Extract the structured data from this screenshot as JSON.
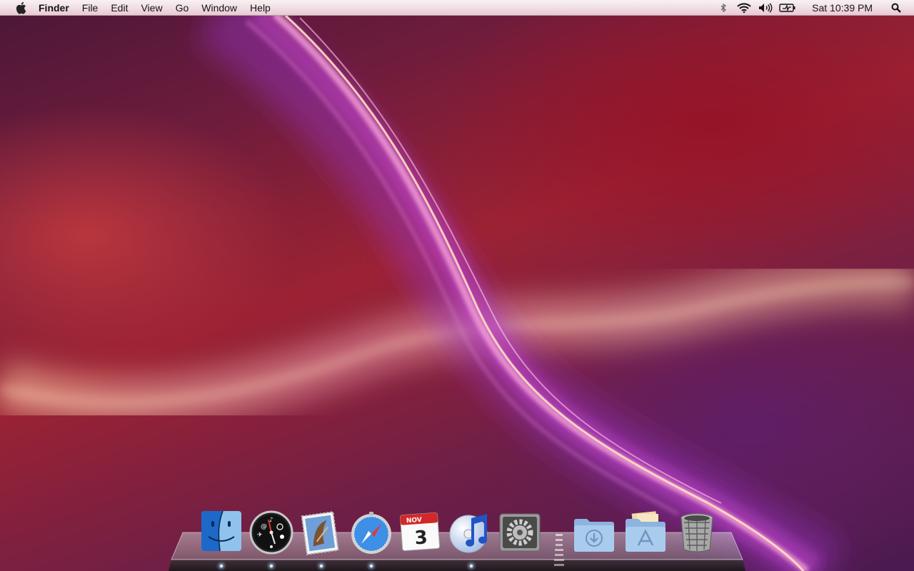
{
  "menubar": {
    "apple_icon": "apple-logo-icon",
    "app_name": "Finder",
    "menus": [
      "File",
      "Edit",
      "View",
      "Go",
      "Window",
      "Help"
    ],
    "status": {
      "icons": [
        "bluetooth-icon",
        "wifi-icon",
        "volume-icon",
        "battery-icon"
      ],
      "clock": "Sat 10:39 PM",
      "spotlight_icon": "spotlight-search-icon"
    }
  },
  "dock": {
    "apps": [
      {
        "icon": "finder-icon",
        "running": true
      },
      {
        "icon": "dashboard-icon",
        "running": true
      },
      {
        "icon": "mail-icon",
        "running": true
      },
      {
        "icon": "safari-icon",
        "running": true
      },
      {
        "icon": "ical-icon",
        "running": false,
        "calendar_month": "NOV",
        "calendar_day": "3"
      },
      {
        "icon": "itunes-icon",
        "running": true
      },
      {
        "icon": "system-preferences-icon",
        "running": false
      }
    ],
    "stacks": [
      {
        "icon": "downloads-folder-icon"
      },
      {
        "icon": "applications-folder-icon"
      },
      {
        "icon": "trash-icon"
      }
    ]
  },
  "colors": {
    "wallpaper_dark": "#4b1737",
    "wallpaper_red": "#9c2233",
    "wallpaper_purple": "#4a1a50",
    "aurora_pink": "#f08ccd",
    "aurora_gold": "#ffd7a0"
  }
}
